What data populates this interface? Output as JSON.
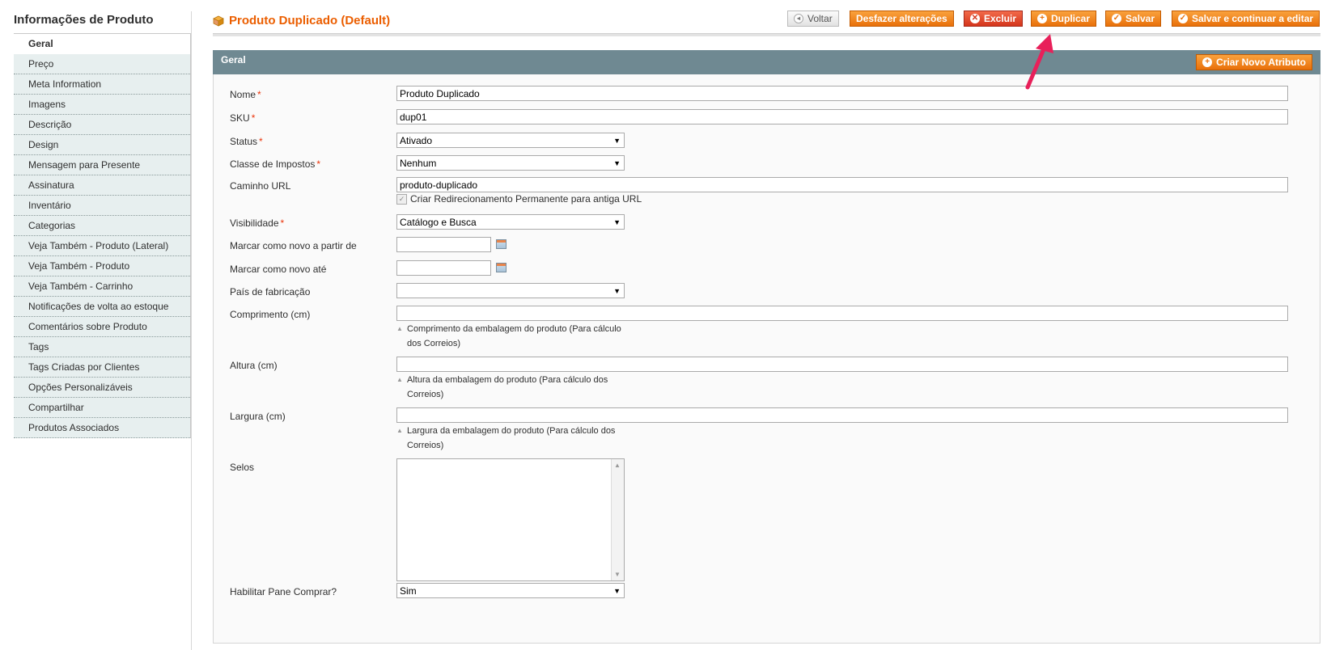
{
  "sidebar": {
    "title": "Informações de Produto",
    "items": [
      {
        "label": "Geral",
        "active": true
      },
      {
        "label": "Preço"
      },
      {
        "label": "Meta Information"
      },
      {
        "label": "Imagens"
      },
      {
        "label": "Descrição"
      },
      {
        "label": "Design"
      },
      {
        "label": "Mensagem para Presente"
      },
      {
        "label": "Assinatura"
      },
      {
        "label": "Inventário"
      },
      {
        "label": "Categorias"
      },
      {
        "label": "Veja Também - Produto (Lateral)"
      },
      {
        "label": "Veja Também - Produto"
      },
      {
        "label": "Veja Também - Carrinho"
      },
      {
        "label": "Notificações de volta ao estoque"
      },
      {
        "label": "Comentários sobre Produto"
      },
      {
        "label": "Tags"
      },
      {
        "label": "Tags Criadas por Clientes"
      },
      {
        "label": "Opções Personalizáveis"
      },
      {
        "label": "Compartilhar"
      },
      {
        "label": "Produtos Associados"
      }
    ]
  },
  "header": {
    "title": "Produto Duplicado (Default)",
    "title_icon": "box-icon",
    "buttons": {
      "back": "Voltar",
      "reset": "Desfazer alterações",
      "delete": "Excluir",
      "duplicate": "Duplicar",
      "save": "Salvar",
      "save_continue": "Salvar e continuar a editar"
    }
  },
  "section": {
    "title": "Geral",
    "new_attribute_button": "Criar Novo Atributo"
  },
  "form": {
    "nome": {
      "label": "Nome",
      "value": "Produto Duplicado"
    },
    "sku": {
      "label": "SKU",
      "value": "dup01"
    },
    "status": {
      "label": "Status",
      "value": "Ativado"
    },
    "tax_class": {
      "label": "Classe de Impostos",
      "value": "Nenhum"
    },
    "url": {
      "label": "Caminho URL",
      "value": "produto-duplicado",
      "checkbox_label": "Criar Redirecionamento Permanente para antiga URL"
    },
    "visibility": {
      "label": "Visibilidade",
      "value": "Catálogo e Busca"
    },
    "new_from": {
      "label": "Marcar como novo a partir de",
      "value": ""
    },
    "new_to": {
      "label": "Marcar como novo até",
      "value": ""
    },
    "country": {
      "label": "País de fabricação",
      "value": ""
    },
    "length": {
      "label": "Comprimento (cm)",
      "value": "",
      "note": "Comprimento da embalagem do produto (Para cálculo dos Correios)"
    },
    "height": {
      "label": "Altura (cm)",
      "value": "",
      "note": "Altura da embalagem do produto (Para cálculo dos Correios)"
    },
    "width": {
      "label": "Largura (cm)",
      "value": "",
      "note": "Largura da embalagem do produto (Para cálculo dos Correios)"
    },
    "seals": {
      "label": "Selos"
    },
    "buy_pane": {
      "label": "Habilitar Pane Comprar?",
      "value": "Sim"
    }
  },
  "required_marker": "*",
  "colors": {
    "accent": "#eb5e00",
    "section_header": "#6f8992",
    "sidebar_item_bg": "#e7efef",
    "annotation_arrow": "#e8205a"
  }
}
